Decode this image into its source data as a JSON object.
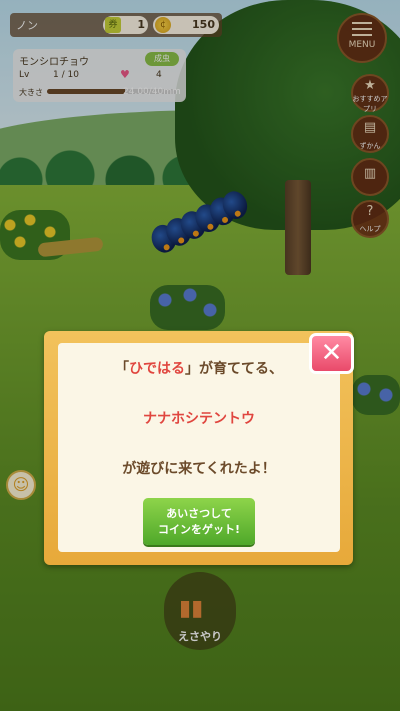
{
  "hud": {
    "player_name": "ノン",
    "ticket_count": "1",
    "coin_count": "150"
  },
  "status": {
    "species": "モンシロチョウ",
    "badge": "成虫",
    "lv_label": "Lv",
    "lv_value": "1 / 10",
    "heart_count": "4",
    "size_label": "大きさ",
    "size_value": "24.00/40mm",
    "size_fraction": 0.6
  },
  "side_menu": {
    "menu_label": "MENU",
    "recommend_label": "おすすめアプリ",
    "zukan_label": "ずかん",
    "note_label": "",
    "help_label": "ヘルプ"
  },
  "dialog": {
    "line1_open": "「",
    "line1_name": "ひではる",
    "line1_rest": "」が育ててる、",
    "line2": "ナナホシテントウ",
    "line3": "が遊びに来てくれたよ！",
    "button_line1": "あいさつして",
    "button_line2": "コインをゲット!",
    "close_glyph": "✕"
  },
  "bottom": {
    "feed_label": "えさやり"
  },
  "icons": {
    "heart": "♥",
    "ticket": "券",
    "coin": "¢",
    "chat": "☺",
    "cups": "▮▮"
  },
  "colors": {
    "accent_red": "#e0463f",
    "button_green": "#4fa82a",
    "frame_gold": "#e7a93a"
  }
}
